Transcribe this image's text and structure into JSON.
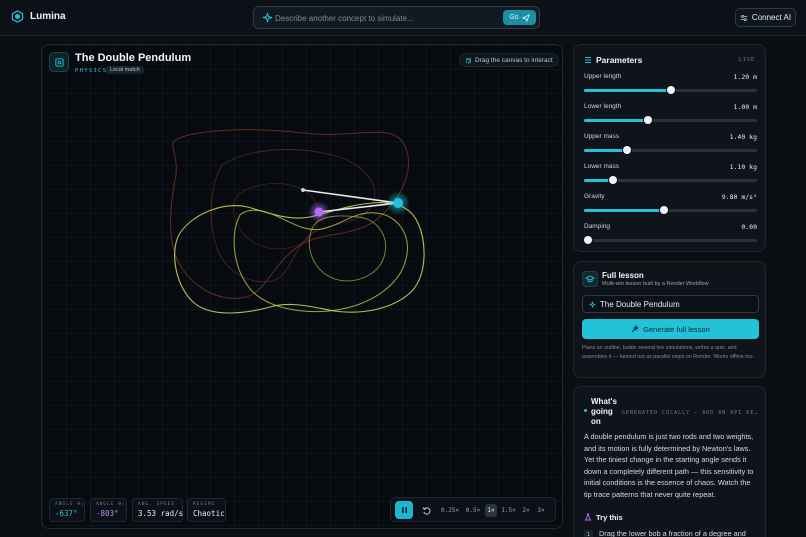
{
  "app": {
    "name": "Lumina"
  },
  "search": {
    "placeholder": "Describe another concept to simulate...",
    "go_label": "Go"
  },
  "header": {
    "connect_label": "Connect AI"
  },
  "simulation": {
    "title": "The Double Pendulum",
    "category": "PHYSICS",
    "match_tag": "Local match",
    "drag_hint": "Drag the canvas to interact",
    "readouts": [
      {
        "label": "ANGLE θ₁",
        "value": "-637°",
        "color": "#2ec5d8"
      },
      {
        "label": "ANGLE θ₂",
        "value": "-803°",
        "color": "#c18bff"
      },
      {
        "label": "ANG. SPEED",
        "value": "3.53 rad/s",
        "color": "#e6edf3"
      },
      {
        "label": "REGIME",
        "value": "Chaotic",
        "color": "#e6edf3"
      }
    ],
    "speeds": [
      "0.25×",
      "0.5×",
      "1×",
      "1.5×",
      "2×",
      "3×"
    ],
    "active_speed": "1×"
  },
  "parameters": {
    "title": "Parameters",
    "status": "LIVE",
    "items": [
      {
        "label": "Upper length",
        "value": "1.20 m",
        "fraction": 0.5
      },
      {
        "label": "Lower length",
        "value": "1.00 m",
        "fraction": 0.37
      },
      {
        "label": "Upper mass",
        "value": "1.40 kg",
        "fraction": 0.25
      },
      {
        "label": "Lower mass",
        "value": "1.10 kg",
        "fraction": 0.17
      },
      {
        "label": "Gravity",
        "value": "9.80 m/s²",
        "fraction": 0.46
      },
      {
        "label": "Damping",
        "value": "0.00",
        "fraction": 0.0
      }
    ]
  },
  "lesson": {
    "title": "Full lesson",
    "subtitle": "Multi-sim lesson built by a Render Workflow",
    "input_value": "The Double Pendulum",
    "button_label": "Generate full lesson",
    "note": "Plans an outline, builds several live simulations, writes a quiz, and assembles it — fanned out as parallel steps on Render. Works offline too."
  },
  "explanation": {
    "title": "What's going on",
    "source": "GENERATED LOCALLY — ADD AN API KE…",
    "body": "A double pendulum is just two rods and two weights, and its motion is fully determined by Newton's laws. Yet the tiniest change in the starting angle sends it down a completely different path — this sensitivity to initial conditions is the essence of chaos. Watch the tip trace patterns that never quite repeat.",
    "try_title": "Try this",
    "try_items": [
      {
        "num": "1",
        "text": "Drag the lower bob a fraction of a degree and"
      }
    ]
  },
  "colors": {
    "accent": "#22c3d9",
    "lower_bob": "#b46cf5",
    "trace_olive": "#c8d35a",
    "trace_red": "#8a3a2e"
  }
}
